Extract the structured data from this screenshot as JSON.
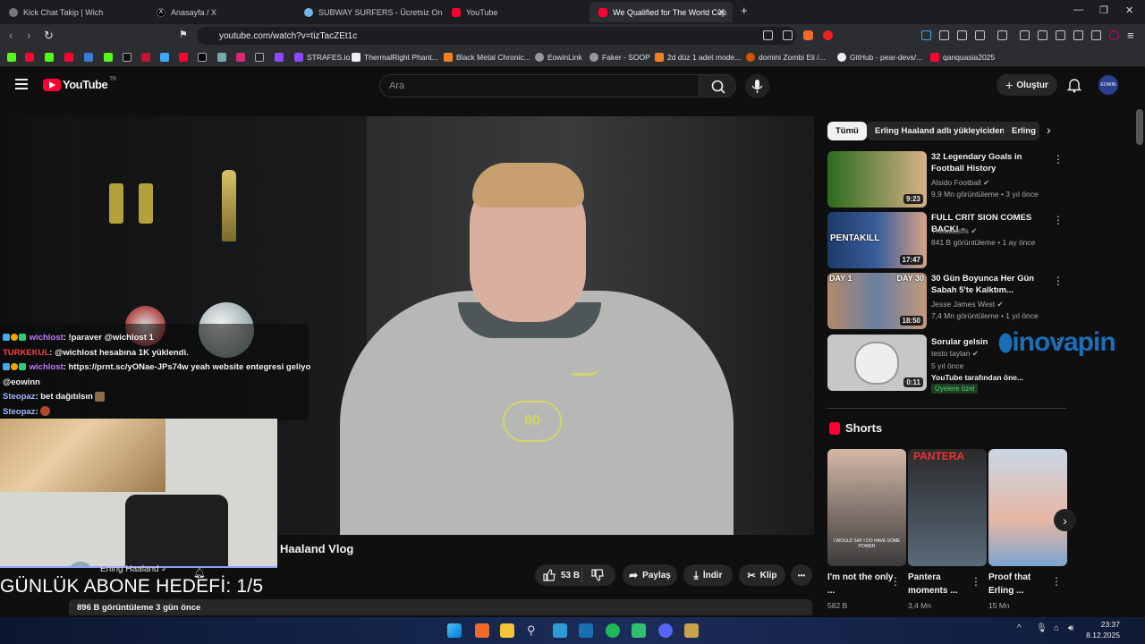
{
  "browser": {
    "tabs": [
      {
        "title": "Kick Chat Takip | Wich",
        "active": false
      },
      {
        "title": "Anasayfa / X",
        "active": false
      },
      {
        "title": "SUBWAY SURFERS - Ücretsiz Online O",
        "active": false
      },
      {
        "title": "YouTube",
        "active": false
      },
      {
        "title": "We Qualified for The World Cup",
        "active": true
      }
    ],
    "url": "youtube.com/watch?v=tizTacZEt1c",
    "bookmarks": [
      "STRAFES.io",
      "ThermalRight Phant...",
      "Black Metal Chronic...",
      "EowinLink",
      "Faker - SOOP",
      "2d düz 1 adet mode...",
      "domini Zombi Eli /...",
      "GitHub - pear-devs/...",
      "qanquasia2025"
    ]
  },
  "youtube": {
    "logo_text": "YouTube",
    "logo_region": "TR",
    "search_placeholder": "Ara",
    "create_label": "Oluştur",
    "avatar_text": "EOWIN"
  },
  "video": {
    "title": "Haaland Vlog",
    "channel": "Erling Haaland",
    "likes": "53 B",
    "share_label": "Paylaş",
    "download_label": "İndir",
    "clip_label": "Klip",
    "more_label": "•••",
    "views_date": "896 B görüntüleme  3 gün önce",
    "jersey_number": "90"
  },
  "stream_overlay": {
    "chat": [
      {
        "user": "wichlost",
        "color": "#c37bff",
        "text": ": !paraver @wichlost 1"
      },
      {
        "user": "TURKEKUL",
        "color": "#ff3d3d",
        "text": ": @wichlost hesabına 1K yüklendi."
      },
      {
        "user": "wichlost",
        "color": "#c37bff",
        "text": ": https://prnt.sc/yONae-JPs74w yeah website entegresi geliyo"
      },
      {
        "user": "",
        "color": "#ffffff",
        "text": "@eowinn"
      },
      {
        "user": "Steopaz",
        "color": "#9fb6ff",
        "text": ": bet dağıtılsın"
      },
      {
        "user": "Steopaz",
        "color": "#9fb6ff",
        "text": ":"
      }
    ],
    "goal_text": "GÜNLÜK ABONE HEDEFİ: 1/5"
  },
  "sidebar": {
    "chips": [
      "Tümü",
      "Erling Haaland adlı yükleyiciden",
      "Erling"
    ],
    "recommendations": [
      {
        "title": "32 Legendary Goals in Football History",
        "channel": "Alsido Football",
        "meta": "9,9 Mn görüntüleme • 3 yıl önce",
        "duration": "9:23"
      },
      {
        "title": "FULL CRIT SION COMES BACK!",
        "channel": "Thebausffs",
        "meta": "841 B görüntüleme • 1 ay önce",
        "duration": "17:47",
        "thumb_text": "PENTAKILL"
      },
      {
        "title": "30 Gün Boyunca Her Gün Sabah 5'te Kalktım...",
        "channel": "Jesse James West",
        "meta": "7,4 Mn görüntüleme • 1 yıl önce",
        "duration": "18:50",
        "thumb_left": "DAY 1",
        "thumb_right": "DAY 30"
      },
      {
        "title": "Sorular gelsin",
        "channel": "testo taylan",
        "meta": "5 yıl önce",
        "extra": "YouTube tarafından öne...",
        "badge": "Üyelere özel",
        "duration": "0:11",
        "watermark": "inovapin"
      }
    ],
    "shorts_heading": "Shorts",
    "shorts": [
      {
        "title": "I'm not the only ...",
        "views": "582 B",
        "thumb_text": "I WOULD SAY I DO HAVE SOME POWER"
      },
      {
        "title": "Pantera moments ...",
        "views": "3,4 Mn",
        "thumb_text": "PANTERA"
      },
      {
        "title": "Proof that Erling ...",
        "views": "15 Mn"
      }
    ]
  },
  "taskbar": {
    "time": "23:37",
    "date": "8.12.2025"
  },
  "colors": {
    "youtube_red": "#ff0033",
    "bg": "#0f0f0f",
    "chip_bg": "#272727"
  }
}
